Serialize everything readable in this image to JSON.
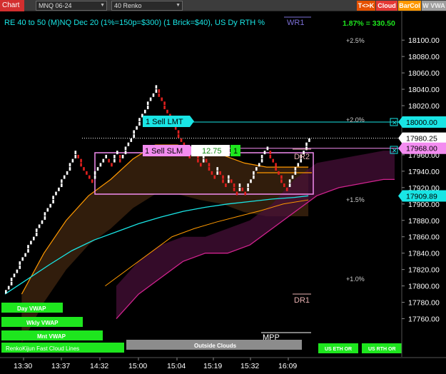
{
  "toolbar": {
    "app_label": "Chart",
    "instrument": "MNQ 06-24",
    "bar_type": "40 Renko",
    "buttons": [
      {
        "label": "T<>K",
        "color": "#e65100"
      },
      {
        "label": "Cloud",
        "color": "#e53935"
      },
      {
        "label": "BarCol",
        "color": "#ff9800"
      },
      {
        "label": "W VWA",
        "color": "#9e9e9e"
      }
    ]
  },
  "header": {
    "title": "RE 40 to 50 (M)NQ Dec 20 (1%=150p=$300) (1 Brick=$40), US Dy RTH %",
    "wr_label": "WR1",
    "change": "1.87% = 330.50"
  },
  "price_axis": {
    "ticks": [
      "18100.00",
      "18080.00",
      "18060.00",
      "18040.00",
      "18020.00",
      "18000.00",
      "17980.00",
      "17960.00",
      "17940.00",
      "17920.00",
      "17900.00",
      "17880.00",
      "17860.00",
      "17840.00",
      "17820.00",
      "17800.00",
      "17780.00",
      "17760.00"
    ],
    "badges": [
      {
        "label": "18000.00",
        "style": "cyan"
      },
      {
        "label": "17980.25",
        "style": "white"
      },
      {
        "label": "17968.00",
        "style": "pink"
      },
      {
        "label": "17909.89",
        "style": "cyan"
      }
    ]
  },
  "time_axis": [
    "13:30",
    "13:37",
    "14:32",
    "15:00",
    "15:04",
    "15:19",
    "15:32",
    "16:09"
  ],
  "percent_levels": [
    "+2.5%",
    "+2.0%",
    "+1.5%",
    "+1.0%"
  ],
  "orders": {
    "sell_lmt": "1 Sell LMT",
    "sell_slm": "1 Sell SLM",
    "slm_value": "12.75",
    "slm_qty": "1"
  },
  "labels": {
    "dr2": "DR2",
    "dr1": "DR1",
    "mpp": "MPP",
    "day_vwap": "Day VWAP",
    "wkly_vwap": "Wkly VWAP",
    "mnt_vwap": "Mnt VWAP",
    "renko_lines": "RenkoKijun Fast Cloud Lines",
    "outside_clouds": "Outside Clouds",
    "us_eth_or": "US ETH OR",
    "us_rth_or": "US RTH OR"
  },
  "colors": {
    "background": "#000000",
    "up_brick": "#ffffff",
    "down_brick": "#e0201e",
    "neutral_brick": "#8a8a8a",
    "cyan": "#19e5e5",
    "pink": "#f38cf0",
    "green": "#1ee61e",
    "orange": "#ff9900",
    "magenta_line": "#d1238f"
  },
  "chart_data": {
    "type": "renko",
    "brick_size": 5,
    "ylim": [
      17752.5,
      18110
    ],
    "bricks": [
      [
        0,
        17790,
        17795,
        1
      ],
      [
        1,
        17795,
        17800,
        1
      ],
      [
        2,
        17800,
        17805,
        1
      ],
      [
        2,
        17805,
        17810,
        1
      ],
      [
        3,
        17810,
        17815,
        1
      ],
      [
        4,
        17815,
        17820,
        1
      ],
      [
        5,
        17820,
        17825,
        1
      ],
      [
        5,
        17825,
        17830,
        1
      ],
      [
        6,
        17830,
        17835,
        1
      ],
      [
        7,
        17835,
        17840,
        1
      ],
      [
        8,
        17840,
        17845,
        1
      ],
      [
        8,
        17845,
        17850,
        1
      ],
      [
        9,
        17850,
        17855,
        1
      ],
      [
        10,
        17855,
        17860,
        1
      ],
      [
        11,
        17860,
        17865,
        1
      ],
      [
        11,
        17865,
        17870,
        1
      ],
      [
        12,
        17870,
        17875,
        1
      ],
      [
        13,
        17875,
        17880,
        1
      ],
      [
        14,
        17880,
        17885,
        1
      ],
      [
        14,
        17885,
        17890,
        1
      ],
      [
        15,
        17890,
        17895,
        1
      ],
      [
        16,
        17895,
        17900,
        1
      ],
      [
        17,
        17900,
        17905,
        1
      ],
      [
        17,
        17905,
        17910,
        1
      ],
      [
        18,
        17910,
        17915,
        1
      ],
      [
        19,
        17915,
        17920,
        1
      ],
      [
        20,
        17920,
        17925,
        1
      ],
      [
        20,
        17925,
        17930,
        1
      ],
      [
        21,
        17930,
        17935,
        1
      ],
      [
        22,
        17935,
        17940,
        1
      ],
      [
        23,
        17940,
        17945,
        1
      ],
      [
        23,
        17945,
        17950,
        1
      ],
      [
        24,
        17950,
        17955,
        1
      ],
      [
        25,
        17955,
        17960,
        1
      ],
      [
        25,
        17960,
        17965,
        1
      ],
      [
        26,
        17955,
        17960,
        0
      ],
      [
        27,
        17950,
        17955,
        0
      ],
      [
        27,
        17945,
        17950,
        0
      ],
      [
        28,
        17940,
        17945,
        0
      ],
      [
        29,
        17935,
        17940,
        0
      ],
      [
        30,
        17930,
        17935,
        0
      ],
      [
        31,
        17925,
        17930,
        0
      ],
      [
        32,
        17930,
        17935,
        1
      ],
      [
        32,
        17935,
        17940,
        1
      ],
      [
        33,
        17940,
        17945,
        1
      ],
      [
        34,
        17945,
        17950,
        1
      ],
      [
        35,
        17950,
        17955,
        1
      ],
      [
        36,
        17955,
        17960,
        1
      ],
      [
        37,
        17950,
        17955,
        0
      ],
      [
        38,
        17945,
        17950,
        0
      ],
      [
        39,
        17950,
        17955,
        1
      ],
      [
        39,
        17955,
        17960,
        1
      ],
      [
        40,
        17960,
        17965,
        1
      ],
      [
        41,
        17955,
        17960,
        0
      ],
      [
        41,
        17950,
        17955,
        0
      ],
      [
        42,
        17955,
        17960,
        1
      ],
      [
        43,
        17960,
        17965,
        1
      ],
      [
        43,
        17965,
        17970,
        1
      ],
      [
        44,
        17970,
        17975,
        1
      ],
      [
        45,
        17975,
        17980,
        1
      ],
      [
        46,
        17980,
        17985,
        1
      ],
      [
        46,
        17985,
        17990,
        1
      ],
      [
        47,
        17990,
        17995,
        1
      ],
      [
        48,
        17995,
        18000,
        1
      ],
      [
        48,
        18000,
        18005,
        1
      ],
      [
        49,
        18005,
        18010,
        1
      ],
      [
        50,
        18010,
        18015,
        1
      ],
      [
        51,
        18015,
        18020,
        1
      ],
      [
        51,
        18020,
        18025,
        1
      ],
      [
        52,
        18025,
        18030,
        1
      ],
      [
        53,
        18030,
        18035,
        1
      ],
      [
        54,
        18035,
        18040,
        1
      ],
      [
        54,
        18040,
        18045,
        1
      ],
      [
        55,
        18035,
        18040,
        0
      ],
      [
        55,
        18030,
        18035,
        0
      ],
      [
        56,
        18025,
        18030,
        0
      ],
      [
        57,
        18020,
        18025,
        0
      ],
      [
        57,
        18015,
        18020,
        0
      ],
      [
        58,
        18010,
        18015,
        0
      ],
      [
        59,
        18005,
        18010,
        0
      ],
      [
        59,
        18000,
        18005,
        0
      ],
      [
        60,
        17995,
        18000,
        0
      ],
      [
        61,
        17990,
        17995,
        0
      ],
      [
        62,
        17985,
        17990,
        0
      ],
      [
        62,
        17980,
        17985,
        0
      ],
      [
        63,
        17975,
        17980,
        0
      ],
      [
        64,
        17970,
        17975,
        0
      ],
      [
        64,
        17965,
        17970,
        0
      ],
      [
        65,
        17960,
        17965,
        0
      ],
      [
        66,
        17955,
        17960,
        0
      ],
      [
        67,
        17960,
        17965,
        1
      ],
      [
        67,
        17965,
        17970,
        1
      ],
      [
        68,
        17960,
        17965,
        0
      ],
      [
        69,
        17955,
        17960,
        0
      ],
      [
        69,
        17950,
        17955,
        0
      ],
      [
        70,
        17945,
        17950,
        0
      ],
      [
        71,
        17950,
        17955,
        1
      ],
      [
        71,
        17955,
        17960,
        1
      ],
      [
        72,
        17950,
        17955,
        0
      ],
      [
        73,
        17945,
        17950,
        0
      ],
      [
        73,
        17940,
        17945,
        0
      ],
      [
        74,
        17935,
        17940,
        0
      ],
      [
        75,
        17930,
        17935,
        0
      ],
      [
        76,
        17935,
        17940,
        1
      ],
      [
        76,
        17940,
        17945,
        1
      ],
      [
        77,
        17935,
        17940,
        0
      ],
      [
        78,
        17930,
        17935,
        0
      ],
      [
        78,
        17925,
        17930,
        0
      ],
      [
        79,
        17920,
        17925,
        0
      ],
      [
        80,
        17925,
        17930,
        1
      ],
      [
        80,
        17930,
        17935,
        1
      ],
      [
        81,
        17925,
        17930,
        0
      ],
      [
        82,
        17920,
        17925,
        0
      ],
      [
        82,
        17915,
        17920,
        0
      ],
      [
        83,
        17910,
        17915,
        0
      ],
      [
        84,
        17915,
        17920,
        1
      ],
      [
        84,
        17920,
        17925,
        1
      ],
      [
        85,
        17915,
        17920,
        0
      ],
      [
        86,
        17910,
        17915,
        0
      ],
      [
        87,
        17915,
        17920,
        1
      ],
      [
        87,
        17920,
        17925,
        1
      ],
      [
        88,
        17925,
        17930,
        1
      ],
      [
        89,
        17930,
        17935,
        1
      ],
      [
        89,
        17935,
        17940,
        1
      ],
      [
        90,
        17940,
        17945,
        1
      ],
      [
        91,
        17945,
        17950,
        1
      ],
      [
        92,
        17950,
        17955,
        1
      ],
      [
        92,
        17955,
        17960,
        1
      ],
      [
        93,
        17960,
        17965,
        1
      ],
      [
        94,
        17965,
        17970,
        1
      ],
      [
        95,
        17960,
        17965,
        0
      ],
      [
        95,
        17955,
        17960,
        0
      ],
      [
        96,
        17950,
        17955,
        0
      ],
      [
        97,
        17945,
        17950,
        0
      ],
      [
        97,
        17940,
        17945,
        0
      ],
      [
        98,
        17935,
        17940,
        0
      ],
      [
        99,
        17930,
        17935,
        0
      ],
      [
        99,
        17925,
        17930,
        0
      ],
      [
        100,
        17920,
        17925,
        0
      ],
      [
        101,
        17915,
        17920,
        0
      ],
      [
        102,
        17920,
        17925,
        1
      ],
      [
        102,
        17925,
        17930,
        1
      ],
      [
        103,
        17930,
        17935,
        1
      ],
      [
        104,
        17935,
        17940,
        1
      ],
      [
        104,
        17940,
        17945,
        1
      ],
      [
        105,
        17945,
        17950,
        1
      ],
      [
        106,
        17950,
        17955,
        1
      ],
      [
        106,
        17955,
        17960,
        1
      ],
      [
        107,
        17960,
        17965,
        1
      ],
      [
        108,
        17965,
        17970,
        1
      ],
      [
        108,
        17970,
        17975,
        1
      ],
      [
        109,
        17975,
        17980,
        1
      ]
    ],
    "day_vwap": [
      [
        0,
        17790
      ],
      [
        8,
        17808
      ],
      [
        16,
        17826
      ],
      [
        24,
        17843
      ],
      [
        32,
        17856
      ],
      [
        40,
        17866
      ],
      [
        48,
        17876
      ],
      [
        56,
        17884
      ],
      [
        64,
        17891
      ],
      [
        72,
        17896
      ],
      [
        80,
        17900
      ],
      [
        88,
        17903
      ],
      [
        96,
        17906
      ],
      [
        104,
        17908
      ],
      [
        109,
        17910
      ]
    ],
    "kijun_upper": [
      [
        6,
        17790
      ],
      [
        14,
        17840
      ],
      [
        22,
        17880
      ],
      [
        30,
        17910
      ],
      [
        38,
        17930
      ],
      [
        46,
        17955
      ],
      [
        54,
        17972
      ],
      [
        62,
        17972
      ],
      [
        70,
        17965
      ],
      [
        78,
        17960
      ],
      [
        86,
        17950
      ],
      [
        94,
        17945
      ],
      [
        102,
        17945
      ],
      [
        109,
        17945
      ]
    ],
    "cloud_lower": [
      [
        36,
        17800
      ],
      [
        44,
        17820
      ],
      [
        52,
        17840
      ],
      [
        60,
        17860
      ],
      [
        68,
        17870
      ],
      [
        76,
        17878
      ],
      [
        84,
        17885
      ],
      [
        92,
        17892
      ],
      [
        100,
        17900
      ],
      [
        109,
        17905
      ]
    ],
    "magenta_cloud_top": [
      [
        40,
        17800
      ],
      [
        48,
        17830
      ],
      [
        56,
        17850
      ],
      [
        64,
        17860
      ],
      [
        72,
        17860
      ],
      [
        80,
        17870
      ],
      [
        88,
        17880
      ],
      [
        96,
        17900
      ],
      [
        104,
        17930
      ],
      [
        112,
        17950
      ],
      [
        120,
        17955
      ],
      [
        128,
        17960
      ],
      [
        136,
        17965
      ],
      [
        140,
        17965
      ]
    ],
    "magenta_cloud_bottom": [
      [
        40,
        17760
      ],
      [
        48,
        17790
      ],
      [
        56,
        17810
      ],
      [
        64,
        17830
      ],
      [
        72,
        17840
      ],
      [
        80,
        17840
      ],
      [
        88,
        17850
      ],
      [
        96,
        17870
      ],
      [
        104,
        17890
      ],
      [
        112,
        17910
      ],
      [
        120,
        17920
      ],
      [
        128,
        17925
      ],
      [
        136,
        17930
      ],
      [
        140,
        17930
      ]
    ],
    "dashed_price": 17980.25,
    "orders": [
      {
        "label": "1 Sell LMT",
        "price": 18000
      },
      {
        "label": "1 Sell SLM",
        "price": 17968
      }
    ]
  }
}
